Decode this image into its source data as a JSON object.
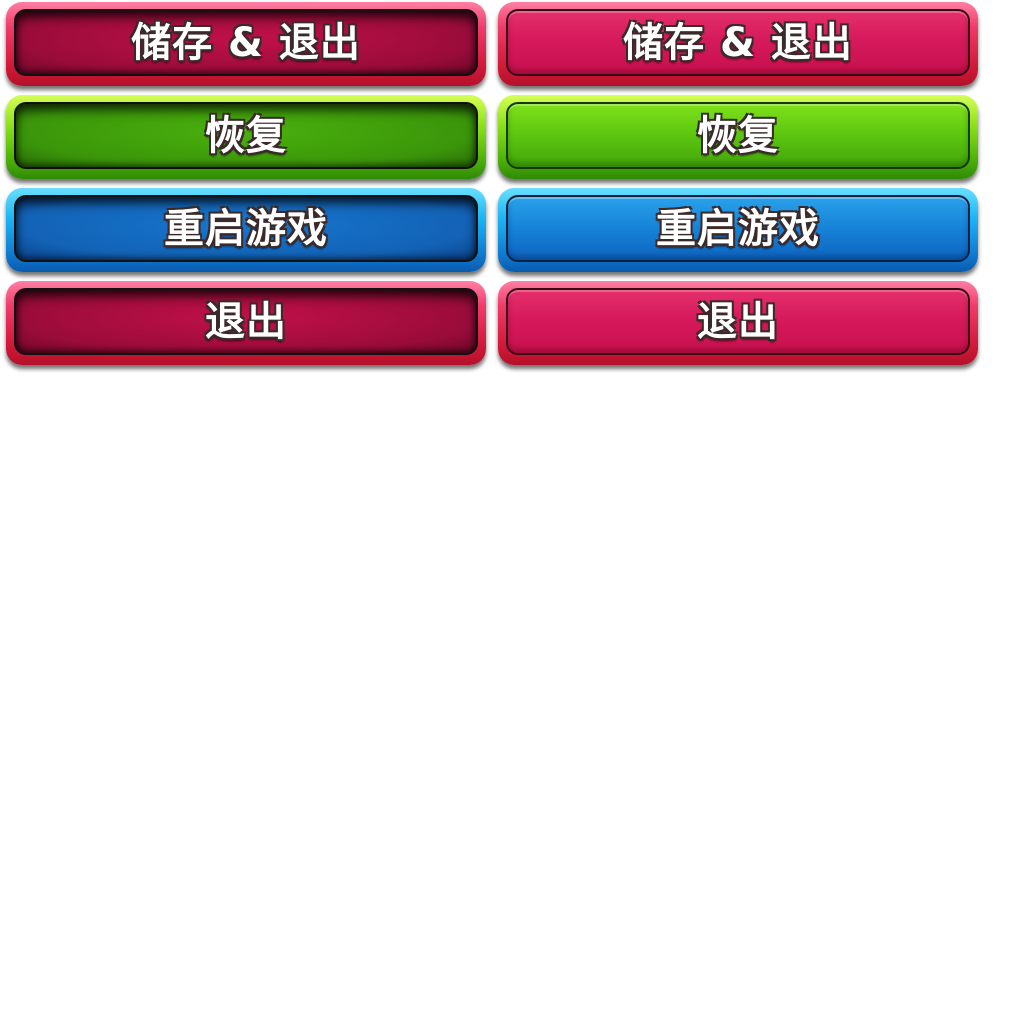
{
  "buttons": {
    "save_exit": {
      "label": "储存 & 退出",
      "color": "#d61a5c"
    },
    "resume": {
      "label": "恢复",
      "color": "#5cc50f"
    },
    "restart": {
      "label": "重启游戏",
      "color": "#1682d8"
    },
    "exit": {
      "label": "退出",
      "color": "#d61a5c"
    }
  },
  "states": [
    "pressed",
    "normal"
  ]
}
